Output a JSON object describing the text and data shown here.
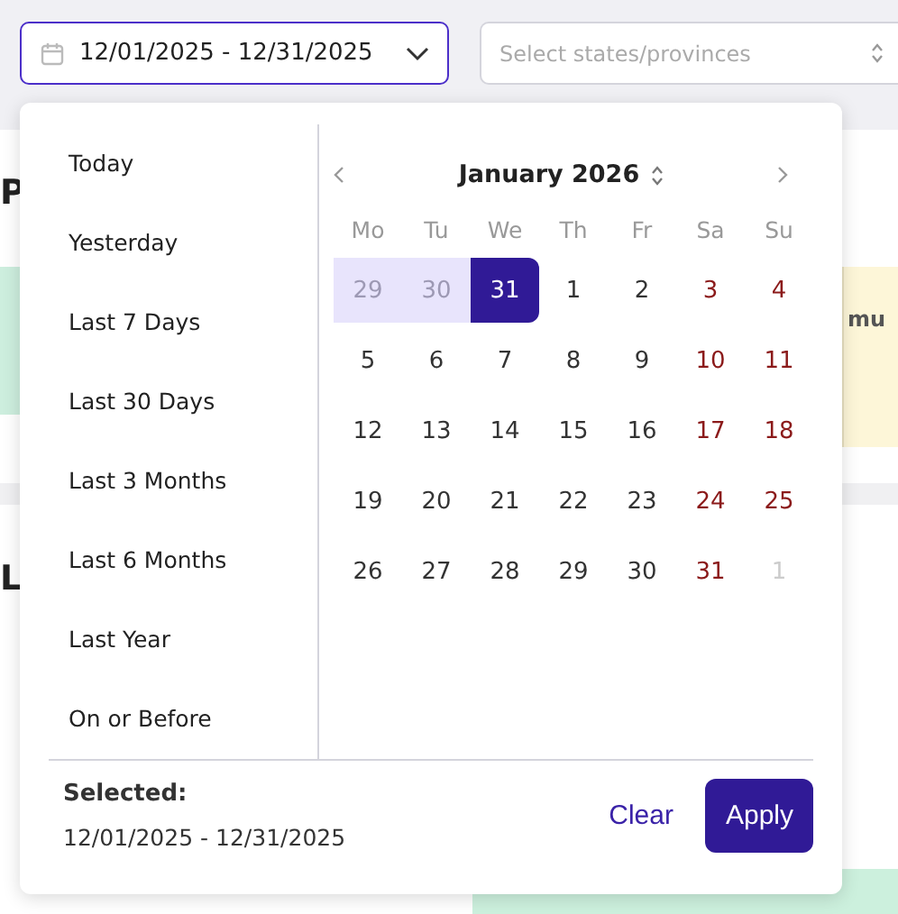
{
  "toolbar": {
    "date_field": {
      "value": "12/01/2025 - 12/31/2025"
    },
    "state_select": {
      "placeholder": "Select states/provinces"
    }
  },
  "background": {
    "heading_1": "P",
    "heading_2": "L",
    "card_text": "mu"
  },
  "date_picker": {
    "presets": [
      {
        "label": "Today"
      },
      {
        "label": "Yesterday"
      },
      {
        "label": "Last 7 Days"
      },
      {
        "label": "Last 30 Days"
      },
      {
        "label": "Last 3 Months"
      },
      {
        "label": "Last 6 Months"
      },
      {
        "label": "Last Year"
      },
      {
        "label": "On or Before"
      }
    ],
    "calendar": {
      "month": "January 2026",
      "weekdays": [
        "Mo",
        "Tu",
        "We",
        "Th",
        "Fr",
        "Sa",
        "Su"
      ],
      "days": [
        {
          "label": "29",
          "outside": true,
          "weekend": false,
          "in_range": true,
          "selected": false
        },
        {
          "label": "30",
          "outside": true,
          "weekend": false,
          "in_range": true,
          "selected": false
        },
        {
          "label": "31",
          "outside": true,
          "weekend": false,
          "in_range": true,
          "selected": true
        },
        {
          "label": "1",
          "outside": false,
          "weekend": false,
          "in_range": false,
          "selected": false
        },
        {
          "label": "2",
          "outside": false,
          "weekend": false,
          "in_range": false,
          "selected": false
        },
        {
          "label": "3",
          "outside": false,
          "weekend": true,
          "in_range": false,
          "selected": false
        },
        {
          "label": "4",
          "outside": false,
          "weekend": true,
          "in_range": false,
          "selected": false
        },
        {
          "label": "5",
          "outside": false,
          "weekend": false,
          "in_range": false,
          "selected": false
        },
        {
          "label": "6",
          "outside": false,
          "weekend": false,
          "in_range": false,
          "selected": false
        },
        {
          "label": "7",
          "outside": false,
          "weekend": false,
          "in_range": false,
          "selected": false
        },
        {
          "label": "8",
          "outside": false,
          "weekend": false,
          "in_range": false,
          "selected": false
        },
        {
          "label": "9",
          "outside": false,
          "weekend": false,
          "in_range": false,
          "selected": false
        },
        {
          "label": "10",
          "outside": false,
          "weekend": true,
          "in_range": false,
          "selected": false
        },
        {
          "label": "11",
          "outside": false,
          "weekend": true,
          "in_range": false,
          "selected": false
        },
        {
          "label": "12",
          "outside": false,
          "weekend": false,
          "in_range": false,
          "selected": false
        },
        {
          "label": "13",
          "outside": false,
          "weekend": false,
          "in_range": false,
          "selected": false
        },
        {
          "label": "14",
          "outside": false,
          "weekend": false,
          "in_range": false,
          "selected": false
        },
        {
          "label": "15",
          "outside": false,
          "weekend": false,
          "in_range": false,
          "selected": false
        },
        {
          "label": "16",
          "outside": false,
          "weekend": false,
          "in_range": false,
          "selected": false
        },
        {
          "label": "17",
          "outside": false,
          "weekend": true,
          "in_range": false,
          "selected": false
        },
        {
          "label": "18",
          "outside": false,
          "weekend": true,
          "in_range": false,
          "selected": false
        },
        {
          "label": "19",
          "outside": false,
          "weekend": false,
          "in_range": false,
          "selected": false
        },
        {
          "label": "20",
          "outside": false,
          "weekend": false,
          "in_range": false,
          "selected": false
        },
        {
          "label": "21",
          "outside": false,
          "weekend": false,
          "in_range": false,
          "selected": false
        },
        {
          "label": "22",
          "outside": false,
          "weekend": false,
          "in_range": false,
          "selected": false
        },
        {
          "label": "23",
          "outside": false,
          "weekend": false,
          "in_range": false,
          "selected": false
        },
        {
          "label": "24",
          "outside": false,
          "weekend": true,
          "in_range": false,
          "selected": false
        },
        {
          "label": "25",
          "outside": false,
          "weekend": true,
          "in_range": false,
          "selected": false
        },
        {
          "label": "26",
          "outside": false,
          "weekend": false,
          "in_range": false,
          "selected": false
        },
        {
          "label": "27",
          "outside": false,
          "weekend": false,
          "in_range": false,
          "selected": false
        },
        {
          "label": "28",
          "outside": false,
          "weekend": false,
          "in_range": false,
          "selected": false
        },
        {
          "label": "29",
          "outside": false,
          "weekend": false,
          "in_range": false,
          "selected": false
        },
        {
          "label": "30",
          "outside": false,
          "weekend": false,
          "in_range": false,
          "selected": false
        },
        {
          "label": "31",
          "outside": false,
          "weekend": true,
          "in_range": false,
          "selected": false
        },
        {
          "label": "1",
          "outside": true,
          "weekend": true,
          "in_range": false,
          "selected": false
        }
      ]
    },
    "footer": {
      "selected_label": "Selected:",
      "selected_value": "12/01/2025 - 12/31/2025",
      "buttons": [
        {
          "label": "Clear",
          "kind": "link"
        },
        {
          "label": "Apply",
          "kind": "primary"
        }
      ]
    }
  }
}
